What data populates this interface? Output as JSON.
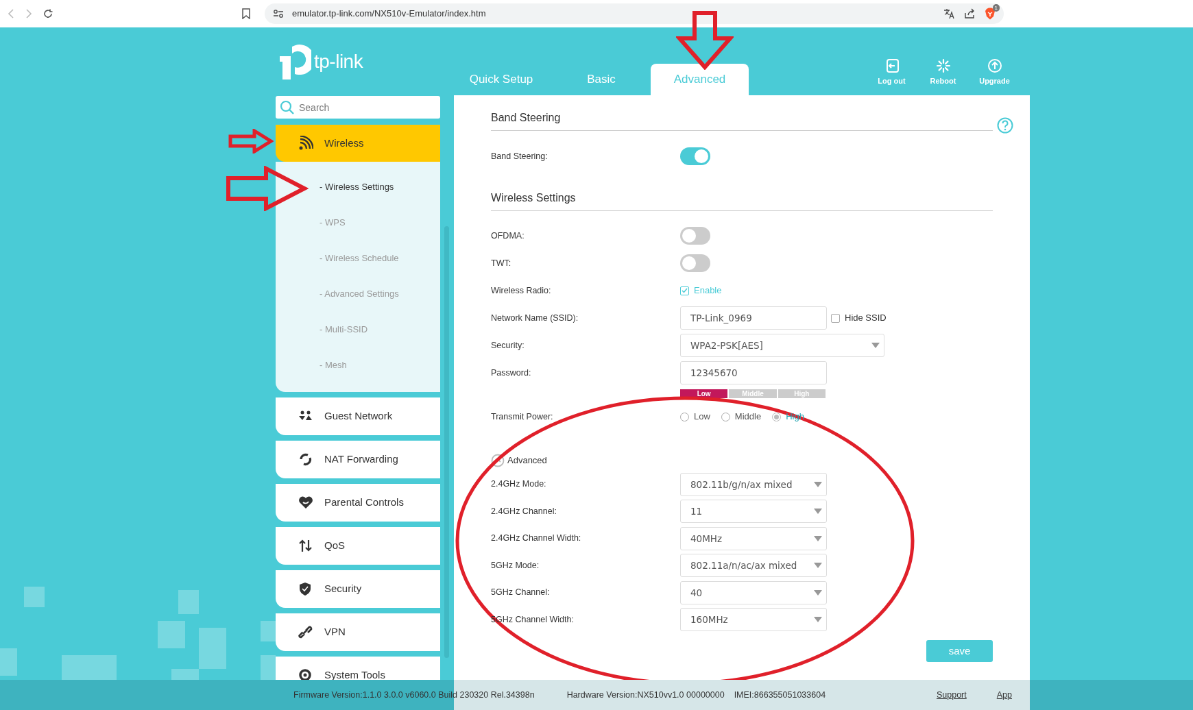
{
  "browser": {
    "url": "emulator.tp-link.com/NX510v-Emulator/index.htm",
    "extension_badge": "1"
  },
  "header": {
    "logo_text": "tp-link",
    "tabs": [
      {
        "label": "Quick Setup",
        "selected": false
      },
      {
        "label": "Basic",
        "selected": false
      },
      {
        "label": "Advanced",
        "selected": true
      }
    ],
    "actions": [
      "Log out",
      "Reboot",
      "Upgrade"
    ]
  },
  "sidebar": {
    "search": {
      "placeholder": "Search"
    },
    "items": [
      {
        "label": "Wireless",
        "selected": true,
        "children": [
          {
            "label": "- Wireless Settings",
            "selected": true
          },
          {
            "label": "- WPS",
            "selected": false
          },
          {
            "label": "- Wireless Schedule",
            "selected": false
          },
          {
            "label": "- Advanced Settings",
            "selected": false
          },
          {
            "label": "- Multi-SSID",
            "selected": false
          },
          {
            "label": "- Mesh",
            "selected": false
          }
        ]
      },
      {
        "label": "Guest Network",
        "selected": false
      },
      {
        "label": "NAT Forwarding",
        "selected": false
      },
      {
        "label": "Parental Controls",
        "selected": false
      },
      {
        "label": "QoS",
        "selected": false
      },
      {
        "label": "Security",
        "selected": false
      },
      {
        "label": "VPN",
        "selected": false
      },
      {
        "label": "System Tools",
        "selected": false
      }
    ]
  },
  "sections": [
    {
      "title": "Band Steering",
      "fields": [
        {
          "kind": "toggle",
          "label": "Band Steering:",
          "on": true
        }
      ]
    },
    {
      "title": "Wireless Settings",
      "fields": [
        {
          "kind": "toggle",
          "label": "OFDMA:",
          "on": false
        },
        {
          "kind": "toggle",
          "label": "TWT:",
          "on": false
        },
        {
          "kind": "checkbox",
          "label": "Wireless Radio:",
          "option": "Enable",
          "checked": true
        },
        {
          "kind": "text",
          "label": "Network Name (SSID):",
          "value": "TP-Link_0969",
          "option": "Hide SSID",
          "checked": false
        },
        {
          "kind": "wide-select",
          "label": "Security:",
          "value": "WPA2-PSK[AES]"
        },
        {
          "kind": "password",
          "label": "Password:",
          "value": "12345670",
          "strength": [
            {
              "label": "Low",
              "selected": true
            },
            {
              "label": "Middle",
              "selected": false
            },
            {
              "label": "High",
              "selected": false
            }
          ]
        },
        {
          "kind": "radio",
          "label": "Transmit Power:",
          "options": [
            {
              "label": "Low",
              "selected": false
            },
            {
              "label": "Middle",
              "selected": false
            },
            {
              "label": "High",
              "selected": true
            }
          ]
        }
      ]
    }
  ],
  "advanced": {
    "label": "Advanced",
    "fields": [
      {
        "label": "2.4GHz Mode:",
        "value": "802.11b/g/n/ax mixed"
      },
      {
        "label": "2.4GHz Channel:",
        "value": "11"
      },
      {
        "label": "2.4GHz Channel Width:",
        "value": "40MHz"
      },
      {
        "label": "5GHz Mode:",
        "value": "802.11a/n/ac/ax mixed"
      },
      {
        "label": "5GHz Channel:",
        "value": "40"
      },
      {
        "label": "5GHz Channel Width:",
        "value": "160MHz"
      }
    ]
  },
  "save_button": "save",
  "footer": {
    "firmware": "Firmware Version:1.1.0 3.0.0 v6060.0 Build 230320 Rel.34398n",
    "hardware": "Hardware Version:NX510vv1.0 00000000",
    "imei": "IMEI:866355051033604",
    "links": [
      "Support",
      "App"
    ]
  }
}
